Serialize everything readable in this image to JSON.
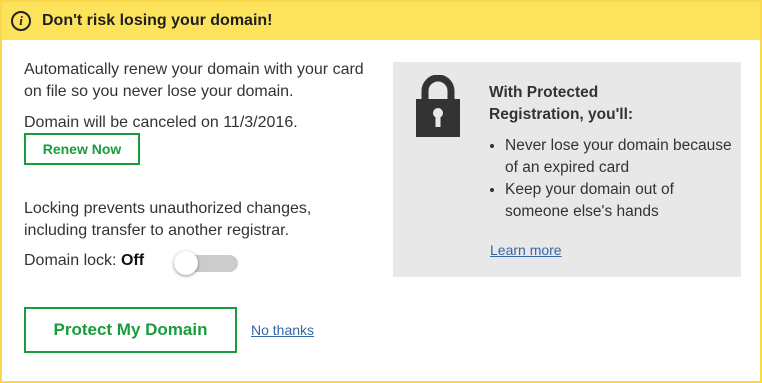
{
  "header": {
    "title": "Don't risk losing your domain!",
    "icon": "info-icon"
  },
  "renewal": {
    "line1": "Automatically renew your domain with your card",
    "line2": "on file so you never lose your domain.",
    "cancel_notice": "Domain will be canceled on 11/3/2016.",
    "renew_button": "Renew Now"
  },
  "lock": {
    "line1": "Locking prevents unauthorized changes,",
    "line2": "including transfer to another registrar.",
    "label": "Domain lock:",
    "state": "Off",
    "enabled": false
  },
  "actions": {
    "protect_button": "Protect My Domain",
    "decline_link": "No thanks"
  },
  "side": {
    "icon": "padlock-icon",
    "title_line1": "With Protected",
    "title_line2": "Registration, you'll:",
    "bullets": [
      "Never lose your domain because of an expired card",
      "Keep your domain out of someone else's hands"
    ],
    "learn_more": "Learn more"
  },
  "colors": {
    "header_bg": "#fde25c",
    "border": "#fbd84a",
    "accent_green": "#1a9c3e",
    "link_blue": "#3567a8",
    "side_bg": "#e8e8e8"
  }
}
